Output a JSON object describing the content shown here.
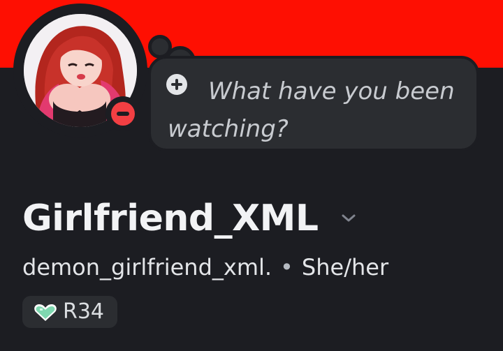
{
  "profile": {
    "display_name": "Girlfriend_XML",
    "username": "demon_girlfriend_xml.",
    "separator": "•",
    "pronouns": "She/her",
    "presence": "do-not-disturb",
    "avatar_icon": "character-avatar-image",
    "banner_color": "#fe0f02"
  },
  "status_bubble": {
    "text": "What have you been watching?",
    "icon": "plus-icon"
  },
  "roles": [
    {
      "label": "R34",
      "icon": "heart-icon",
      "color": "#7fd8b0"
    }
  ]
}
